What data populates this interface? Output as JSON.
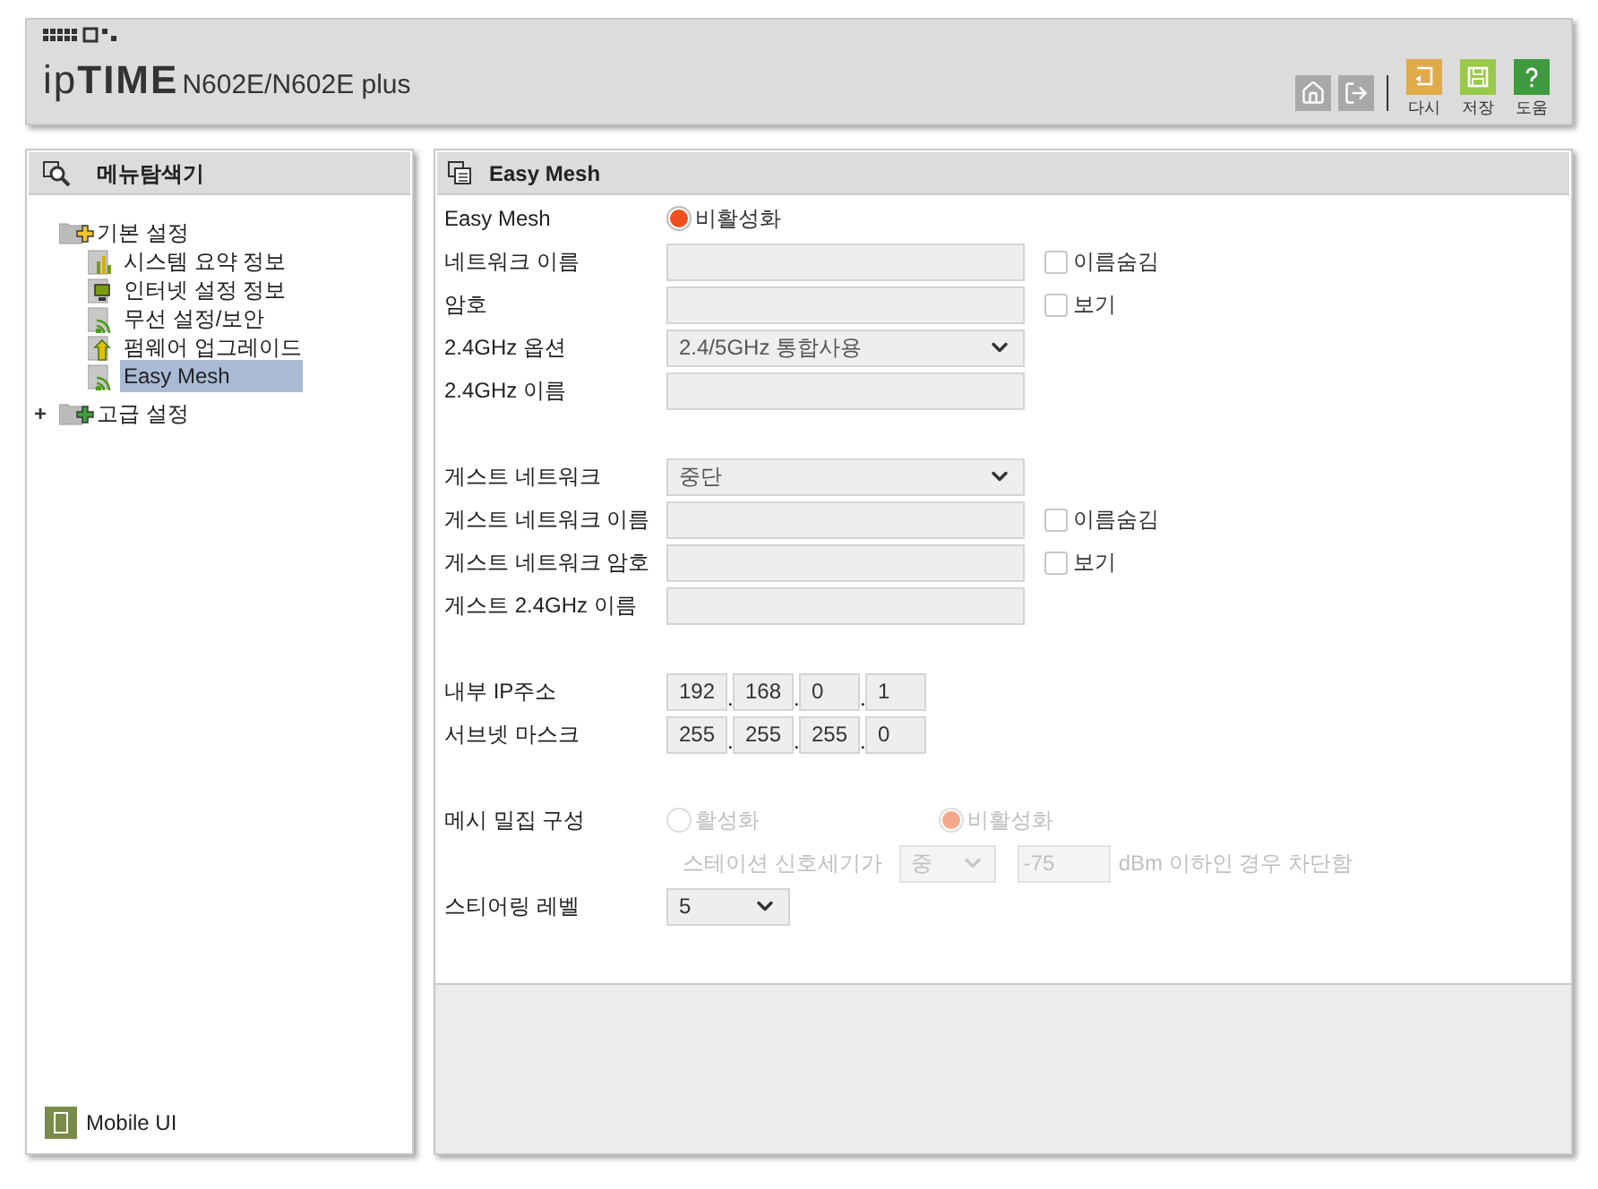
{
  "header": {
    "brand": "ip**TIME**",
    "model": "N602E/N602E plus",
    "tools": [
      {
        "kind": "home"
      },
      {
        "kind": "logout"
      }
    ],
    "actions": [
      {
        "kind": "reset",
        "label": "다시"
      },
      {
        "kind": "save",
        "label": "저장"
      },
      {
        "kind": "help",
        "label": "도움"
      }
    ]
  },
  "sidebar": {
    "title": "메뉴탐색기",
    "tree": [
      {
        "label": "기본 설정",
        "kind": "folder",
        "expanded": true,
        "children": [
          {
            "label": "시스템 요약 정보",
            "kind": "chart",
            "selected": false
          },
          {
            "label": "인터넷 설정 정보",
            "kind": "monitor",
            "selected": false
          },
          {
            "label": "무선 설정/보안",
            "kind": "wireless",
            "selected": false
          },
          {
            "label": "펌웨어 업그레이드",
            "kind": "upgrade",
            "selected": false
          },
          {
            "label": "Easy Mesh",
            "kind": "wireless",
            "selected": true
          }
        ]
      },
      {
        "label": "고급 설정",
        "kind": "folder",
        "expanded": false,
        "toggle": "+"
      }
    ],
    "footer_link": "Mobile UI"
  },
  "panel": {
    "title": "Easy Mesh",
    "groups": [
      [
        {
          "kind": "radio",
          "label": "Easy Mesh",
          "disabled": false,
          "options": [
            {
              "label": "비활성화",
              "selected": true
            }
          ]
        },
        {
          "kind": "text",
          "label": "네트워크 이름",
          "check": {
            "label": "이름숨김",
            "checked": false
          }
        },
        {
          "kind": "text",
          "label": "암호",
          "check": {
            "label": "보기",
            "checked": false
          }
        },
        {
          "kind": "select",
          "label": "2.4GHz 옵션",
          "value": "2.4/5GHz 통합사용"
        },
        {
          "kind": "text",
          "label": "2.4GHz 이름"
        }
      ],
      [
        {
          "kind": "select",
          "label": "게스트 네트워크",
          "value": "중단"
        },
        {
          "kind": "text",
          "label": "게스트 네트워크 이름",
          "check": {
            "label": "이름숨김",
            "checked": false
          }
        },
        {
          "kind": "text",
          "label": "게스트 네트워크 암호",
          "check": {
            "label": "보기",
            "checked": false
          }
        },
        {
          "kind": "text",
          "label": "게스트 2.4GHz 이름"
        }
      ],
      [
        {
          "kind": "ip",
          "label": "내부 IP주소",
          "octets": [
            {
              "value": "192"
            },
            {
              "dot": ".",
              "value": "168"
            },
            {
              "dot": ".",
              "value": "0"
            },
            {
              "dot": ".",
              "value": "1"
            }
          ]
        },
        {
          "kind": "ip",
          "label": "서브넷 마스크",
          "octets": [
            {
              "value": "255"
            },
            {
              "dot": ".",
              "value": "255"
            },
            {
              "dot": ".",
              "value": "255"
            },
            {
              "dot": ".",
              "value": "0"
            }
          ]
        }
      ],
      [
        {
          "kind": "radio",
          "label": "메시 밀집 구성",
          "disabled": true,
          "options": [
            {
              "label": "활성화",
              "selected": false
            },
            {
              "label": "비활성화",
              "selected": true
            }
          ]
        },
        {
          "kind": "threshold",
          "prefix": "스테이션 신호세기가",
          "level": "중",
          "value": "-75",
          "suffix": "dBm 이하인 경우 차단함",
          "disabled": true
        },
        {
          "kind": "small_select",
          "label": "스티어링 레벨",
          "value": "5"
        }
      ]
    ]
  }
}
